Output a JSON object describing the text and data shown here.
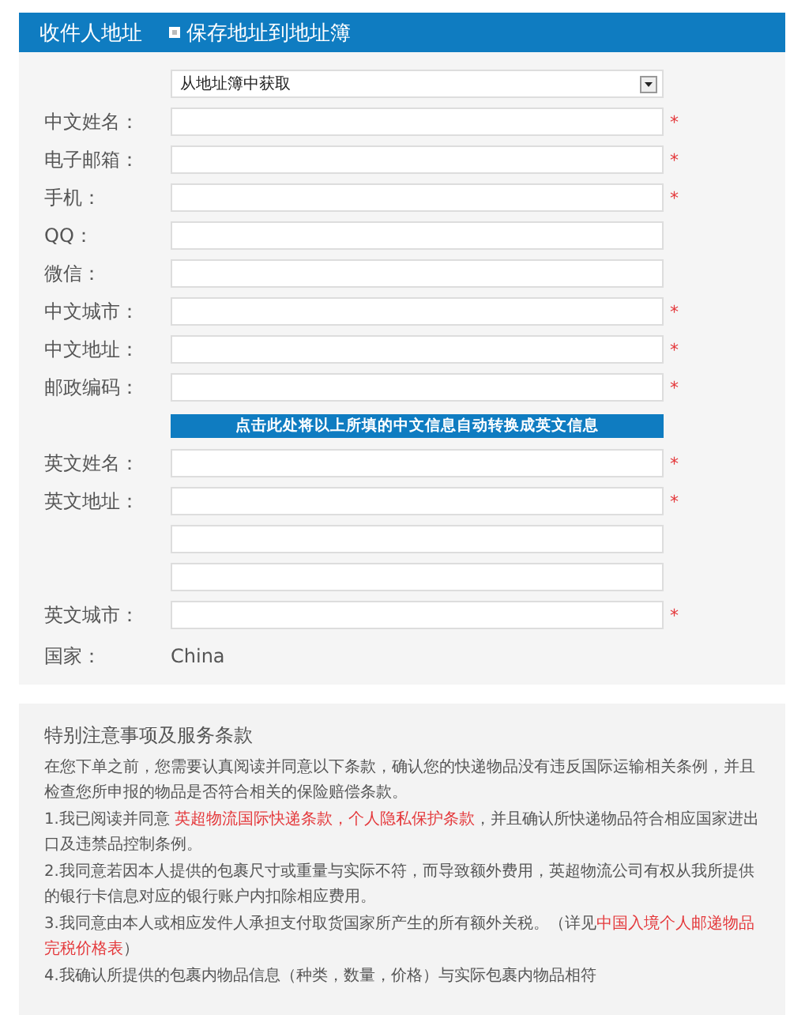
{
  "header": {
    "title": "收件人地址",
    "save_checkbox": {
      "label": "保存地址到地址簿",
      "checked": true
    }
  },
  "address_book_select": {
    "value": "从地址簿中获取"
  },
  "fields": [
    {
      "label": "中文姓名：",
      "required_mark": "*"
    },
    {
      "label": "电子邮箱：",
      "required_mark": "*"
    },
    {
      "label": "手机：",
      "required_mark": "*"
    },
    {
      "label": "QQ："
    },
    {
      "label": "微信："
    },
    {
      "label": "中文城市：",
      "required_mark": "*"
    },
    {
      "label": "中文地址：",
      "required_mark": "*"
    },
    {
      "label": "邮政编码：",
      "required_mark": "*"
    }
  ],
  "convert_button": "点击此处将以上所填的中文信息自动转换成英文信息",
  "english_fields": [
    {
      "kind": "labeled",
      "label": "英文姓名：",
      "required_mark": "*"
    },
    {
      "kind": "labeled",
      "label": "英文地址：",
      "required_mark": "*"
    },
    {
      "kind": "continuation"
    },
    {
      "kind": "continuation"
    },
    {
      "kind": "labeled",
      "label": "英文城市：",
      "required_mark": "*"
    }
  ],
  "country": {
    "label": "国家：",
    "value": "China"
  },
  "terms": {
    "title": "特别注意事项及服务条款",
    "paragraphs": [
      [
        {
          "kind": "text",
          "text": "在您下单之前，您需要认真阅读并同意以下条款，确认您的快递物品没有违反国际运输相关条例，并且检查您所申报的物品是否符合相关的保险赔偿条款。"
        }
      ],
      [
        {
          "kind": "text",
          "text": "1.我已阅读并同意 "
        },
        {
          "kind": "link",
          "text": "英超物流国际快递条款"
        },
        {
          "kind": "link",
          "text": "，"
        },
        {
          "kind": "link",
          "text": "个人隐私保护条款"
        },
        {
          "kind": "text",
          "text": "，并且确认所快递物品符合相应国家进出口及违禁品控制条例。"
        }
      ],
      [
        {
          "kind": "text",
          "text": "2.我同意若因本人提供的包裹尺寸或重量与实际不符，而导致额外费用，英超物流公司有权从我所提供的银行卡信息对应的银行账户内扣除相应费用。"
        }
      ],
      [
        {
          "kind": "text",
          "text": "3.我同意由本人或相应发件人承担支付取货国家所产生的所有额外关税。（详见"
        },
        {
          "kind": "link",
          "text": "中国入境个人邮递物品"
        },
        {
          "kind": "link",
          "text": "完税价格表"
        },
        {
          "kind": "text",
          "text": "）"
        }
      ],
      [
        {
          "kind": "text",
          "text": "4.我确认所提供的包裹内物品信息（种类，数量，价格）与实际包裹内物品相符"
        }
      ]
    ]
  }
}
